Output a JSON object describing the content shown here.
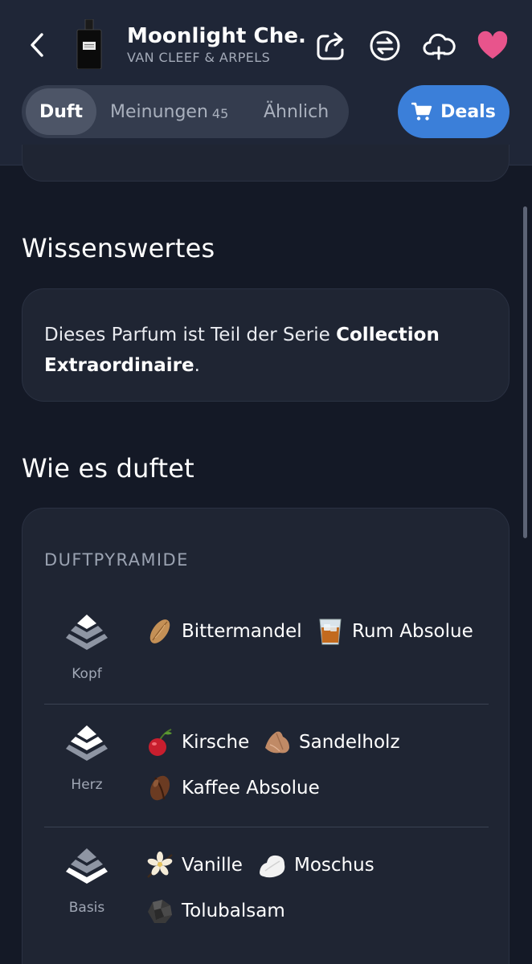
{
  "header": {
    "title": "Moonlight Che...",
    "brand": "VAN CLEEF & ARPELS",
    "icons": [
      "back-arrow-icon",
      "share-icon",
      "compare-icon",
      "cloud-add-icon",
      "heart-icon"
    ],
    "heart_color": "#e8548c"
  },
  "tabs": [
    {
      "label": "Duft",
      "active": true
    },
    {
      "label": "Meinungen",
      "count": "45"
    },
    {
      "label": "Ähnlich"
    }
  ],
  "deals": {
    "label": "Deals",
    "color": "#3b7fd9"
  },
  "facts": {
    "heading": "Wissenswertes",
    "text_prefix": "Dieses Parfum ist Teil der Serie ",
    "series": "Collection Extraordinaire",
    "text_suffix": "."
  },
  "scent": {
    "heading": "Wie es duftet",
    "pyramid_label": "DUFTPYRAMIDE",
    "tiers": [
      {
        "name": "Kopf",
        "notes": [
          {
            "label": "Bittermandel",
            "icon": "almond-icon"
          },
          {
            "label": "Rum Absolue",
            "icon": "rum-icon"
          }
        ]
      },
      {
        "name": "Herz",
        "notes": [
          {
            "label": "Kirsche",
            "icon": "cherry-icon"
          },
          {
            "label": "Sandelholz",
            "icon": "sandalwood-icon"
          },
          {
            "label": "Kaffee Absolue",
            "icon": "coffee-icon"
          }
        ]
      },
      {
        "name": "Basis",
        "notes": [
          {
            "label": "Vanille",
            "icon": "vanilla-icon"
          },
          {
            "label": "Moschus",
            "icon": "musk-icon"
          },
          {
            "label": "Tolubalsam",
            "icon": "tolu-balsam-icon"
          }
        ]
      }
    ]
  }
}
